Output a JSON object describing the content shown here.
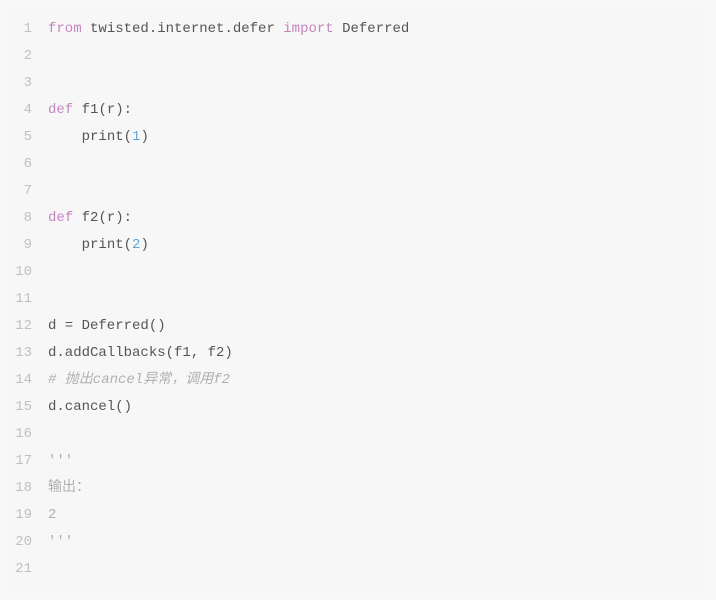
{
  "code": {
    "lines": [
      {
        "n": "1",
        "segments": [
          {
            "cls": "kw-import",
            "t": "from"
          },
          {
            "cls": "",
            "t": " "
          },
          {
            "cls": "module",
            "t": "twisted.internet.defer"
          },
          {
            "cls": "",
            "t": " "
          },
          {
            "cls": "kw-import",
            "t": "import"
          },
          {
            "cls": "",
            "t": " "
          },
          {
            "cls": "identifier",
            "t": "Deferred"
          }
        ]
      },
      {
        "n": "2",
        "segments": []
      },
      {
        "n": "3",
        "segments": []
      },
      {
        "n": "4",
        "segments": [
          {
            "cls": "kw-def",
            "t": "def"
          },
          {
            "cls": "",
            "t": " "
          },
          {
            "cls": "identifier",
            "t": "f1"
          },
          {
            "cls": "paren",
            "t": "(r):"
          }
        ]
      },
      {
        "n": "5",
        "segments": [
          {
            "cls": "",
            "t": "    "
          },
          {
            "cls": "func-call",
            "t": "print"
          },
          {
            "cls": "paren",
            "t": "("
          },
          {
            "cls": "number",
            "t": "1"
          },
          {
            "cls": "paren",
            "t": ")"
          }
        ]
      },
      {
        "n": "6",
        "segments": []
      },
      {
        "n": "7",
        "segments": []
      },
      {
        "n": "8",
        "segments": [
          {
            "cls": "kw-def",
            "t": "def"
          },
          {
            "cls": "",
            "t": " "
          },
          {
            "cls": "identifier",
            "t": "f2"
          },
          {
            "cls": "paren",
            "t": "(r):"
          }
        ]
      },
      {
        "n": "9",
        "segments": [
          {
            "cls": "",
            "t": "    "
          },
          {
            "cls": "func-call",
            "t": "print"
          },
          {
            "cls": "paren",
            "t": "("
          },
          {
            "cls": "number",
            "t": "2"
          },
          {
            "cls": "paren",
            "t": ")"
          }
        ]
      },
      {
        "n": "10",
        "segments": []
      },
      {
        "n": "11",
        "segments": []
      },
      {
        "n": "12",
        "segments": [
          {
            "cls": "identifier",
            "t": "d = Deferred()"
          }
        ]
      },
      {
        "n": "13",
        "segments": [
          {
            "cls": "identifier",
            "t": "d.addCallbacks(f1, f2)"
          }
        ]
      },
      {
        "n": "14",
        "segments": [
          {
            "cls": "comment",
            "t": "# 抛出cancel异常，调用f2"
          }
        ]
      },
      {
        "n": "15",
        "segments": [
          {
            "cls": "identifier",
            "t": "d.cancel()"
          }
        ]
      },
      {
        "n": "16",
        "segments": []
      },
      {
        "n": "17",
        "segments": [
          {
            "cls": "string",
            "t": "'''"
          }
        ]
      },
      {
        "n": "18",
        "segments": [
          {
            "cls": "string",
            "t": "输出："
          }
        ]
      },
      {
        "n": "19",
        "segments": [
          {
            "cls": "string",
            "t": "2"
          }
        ]
      },
      {
        "n": "20",
        "segments": [
          {
            "cls": "string",
            "t": "'''"
          }
        ]
      },
      {
        "n": "21",
        "segments": []
      }
    ]
  }
}
